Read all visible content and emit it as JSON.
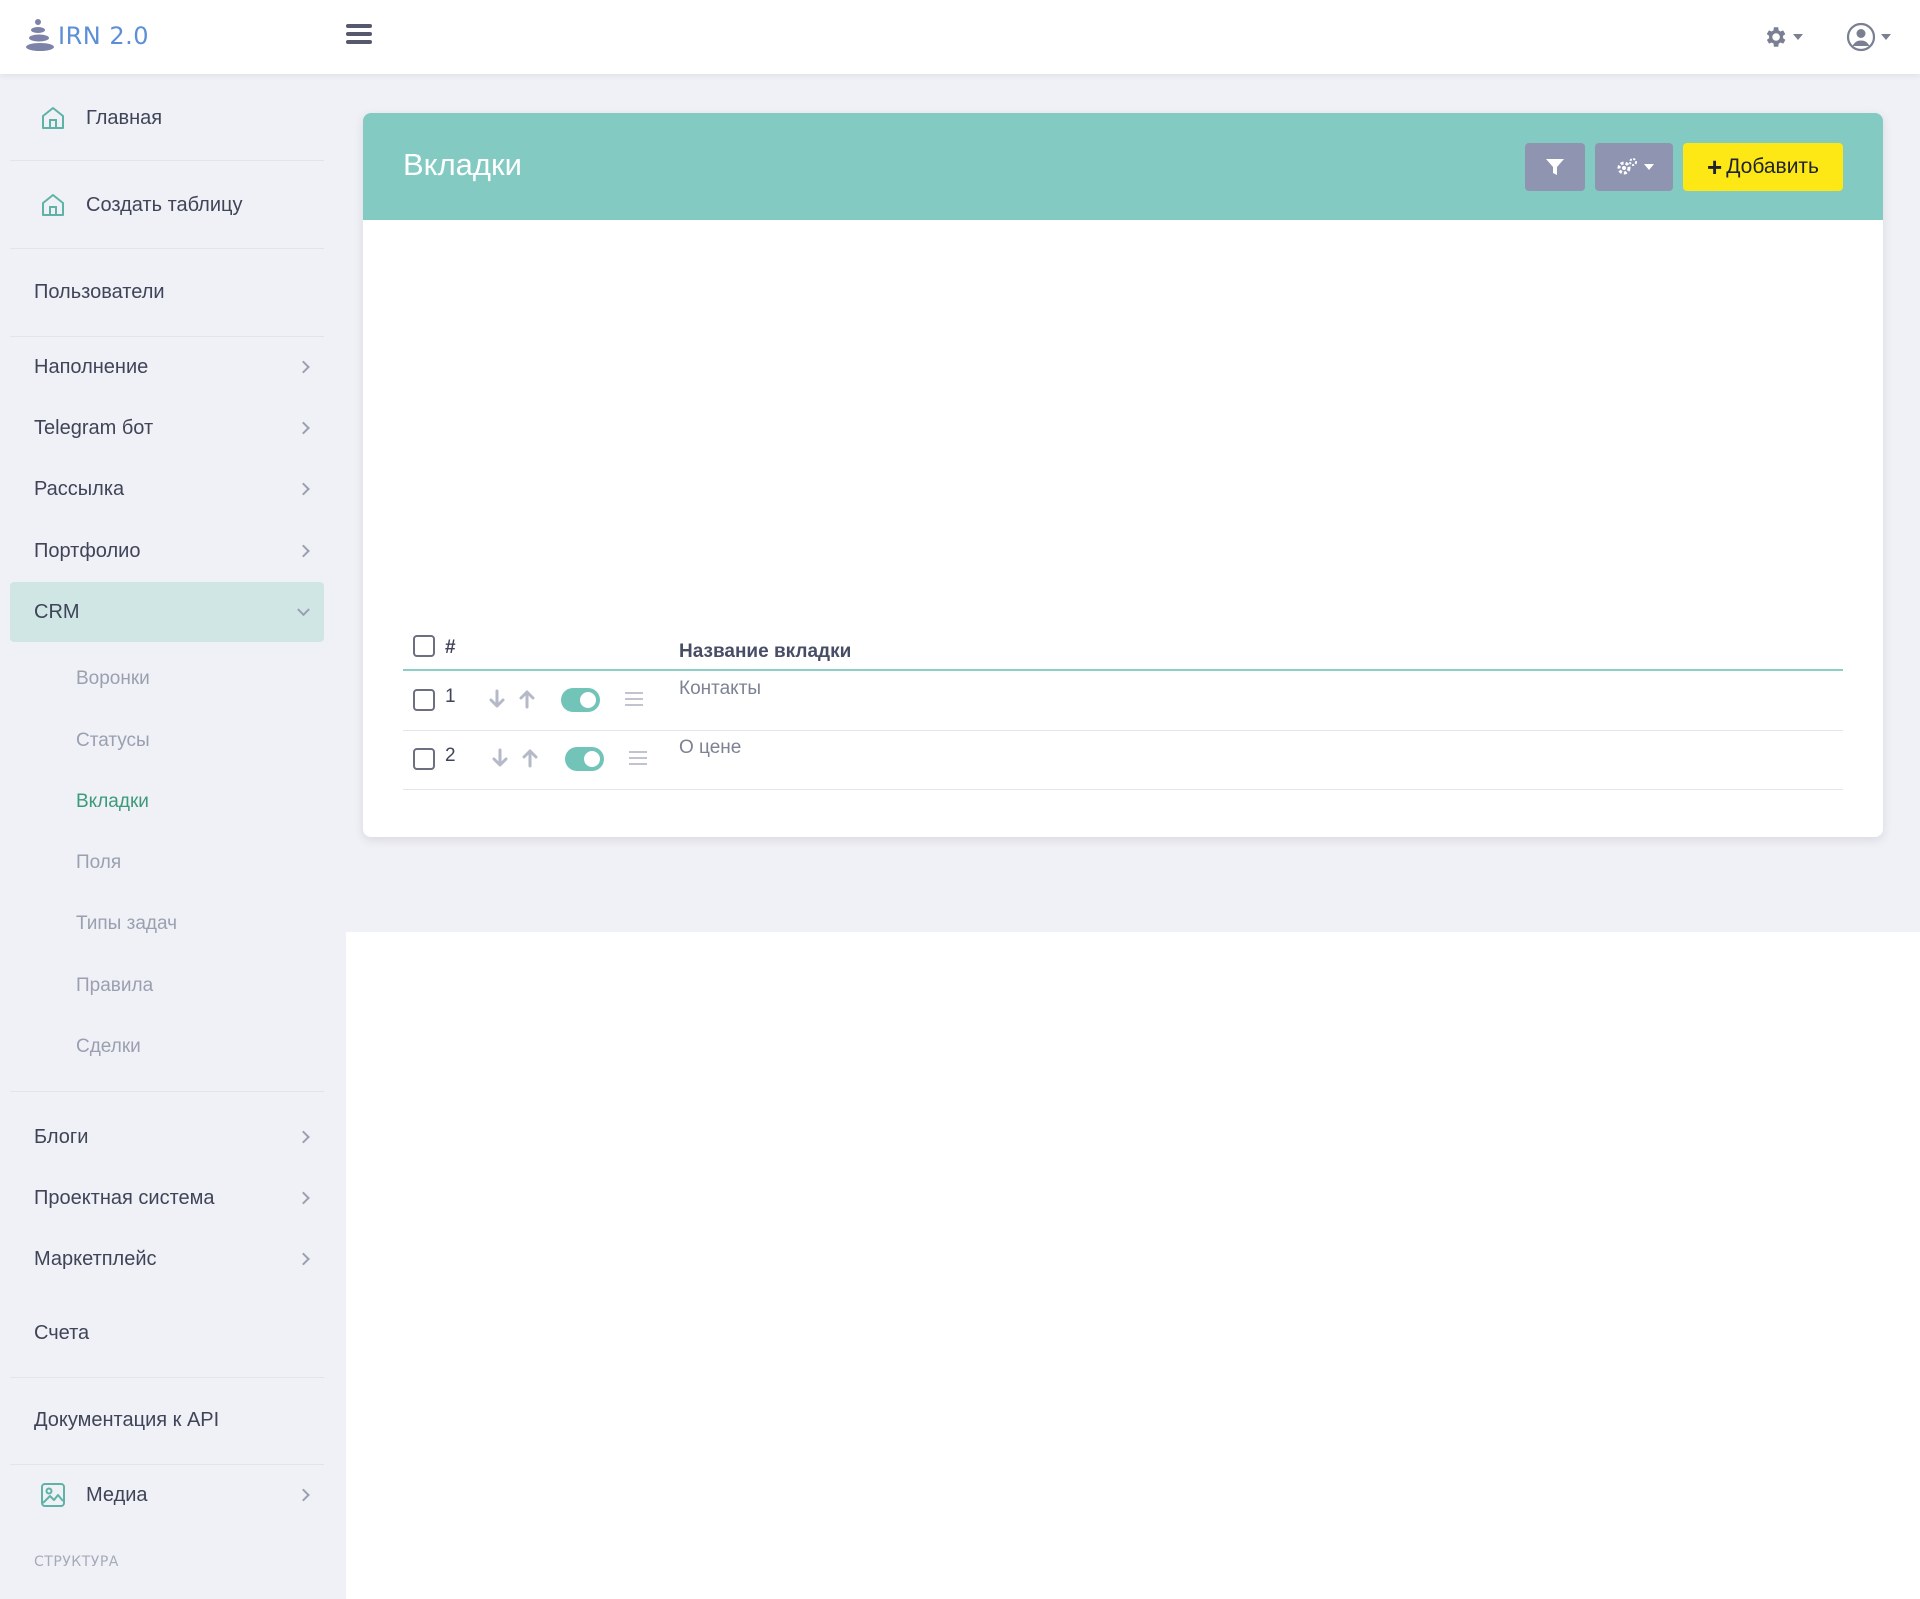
{
  "app": {
    "logo_text": "IRN 2.0"
  },
  "sidebar": {
    "items": [
      {
        "label": "Главная",
        "icon": "home-icon"
      },
      {
        "label": "Создать таблицу",
        "icon": "home-icon"
      },
      {
        "label": "Пользователи"
      },
      {
        "label": "Наполнение"
      },
      {
        "label": "Telegram бот"
      },
      {
        "label": "Рассылка"
      },
      {
        "label": "Портфолио"
      },
      {
        "label": "CRM",
        "expanded": true
      },
      {
        "label": "Блоги"
      },
      {
        "label": "Проектная система"
      },
      {
        "label": "Маркетплейс"
      },
      {
        "label": "Счета"
      },
      {
        "label": "Документация к API"
      },
      {
        "label": "Медиа",
        "icon": "image-icon"
      }
    ],
    "crm_subitems": [
      {
        "label": "Воронки"
      },
      {
        "label": "Статусы"
      },
      {
        "label": "Вкладки",
        "current": true
      },
      {
        "label": "Поля"
      },
      {
        "label": "Типы задач"
      },
      {
        "label": "Правила"
      },
      {
        "label": "Сделки"
      }
    ],
    "section_label": "СТРУКТУРА"
  },
  "page": {
    "title": "Вкладки",
    "add_label": "Добавить"
  },
  "table": {
    "headers": {
      "num": "#",
      "title": "Название вкладки"
    },
    "rows": [
      {
        "num": "1",
        "title": "Контакты"
      },
      {
        "num": "2",
        "title": "О цене"
      }
    ]
  },
  "colors": {
    "header": "#82cac2",
    "accent": "#3c9a78",
    "add_button": "#fde714",
    "toggle": "#72c4b9"
  }
}
